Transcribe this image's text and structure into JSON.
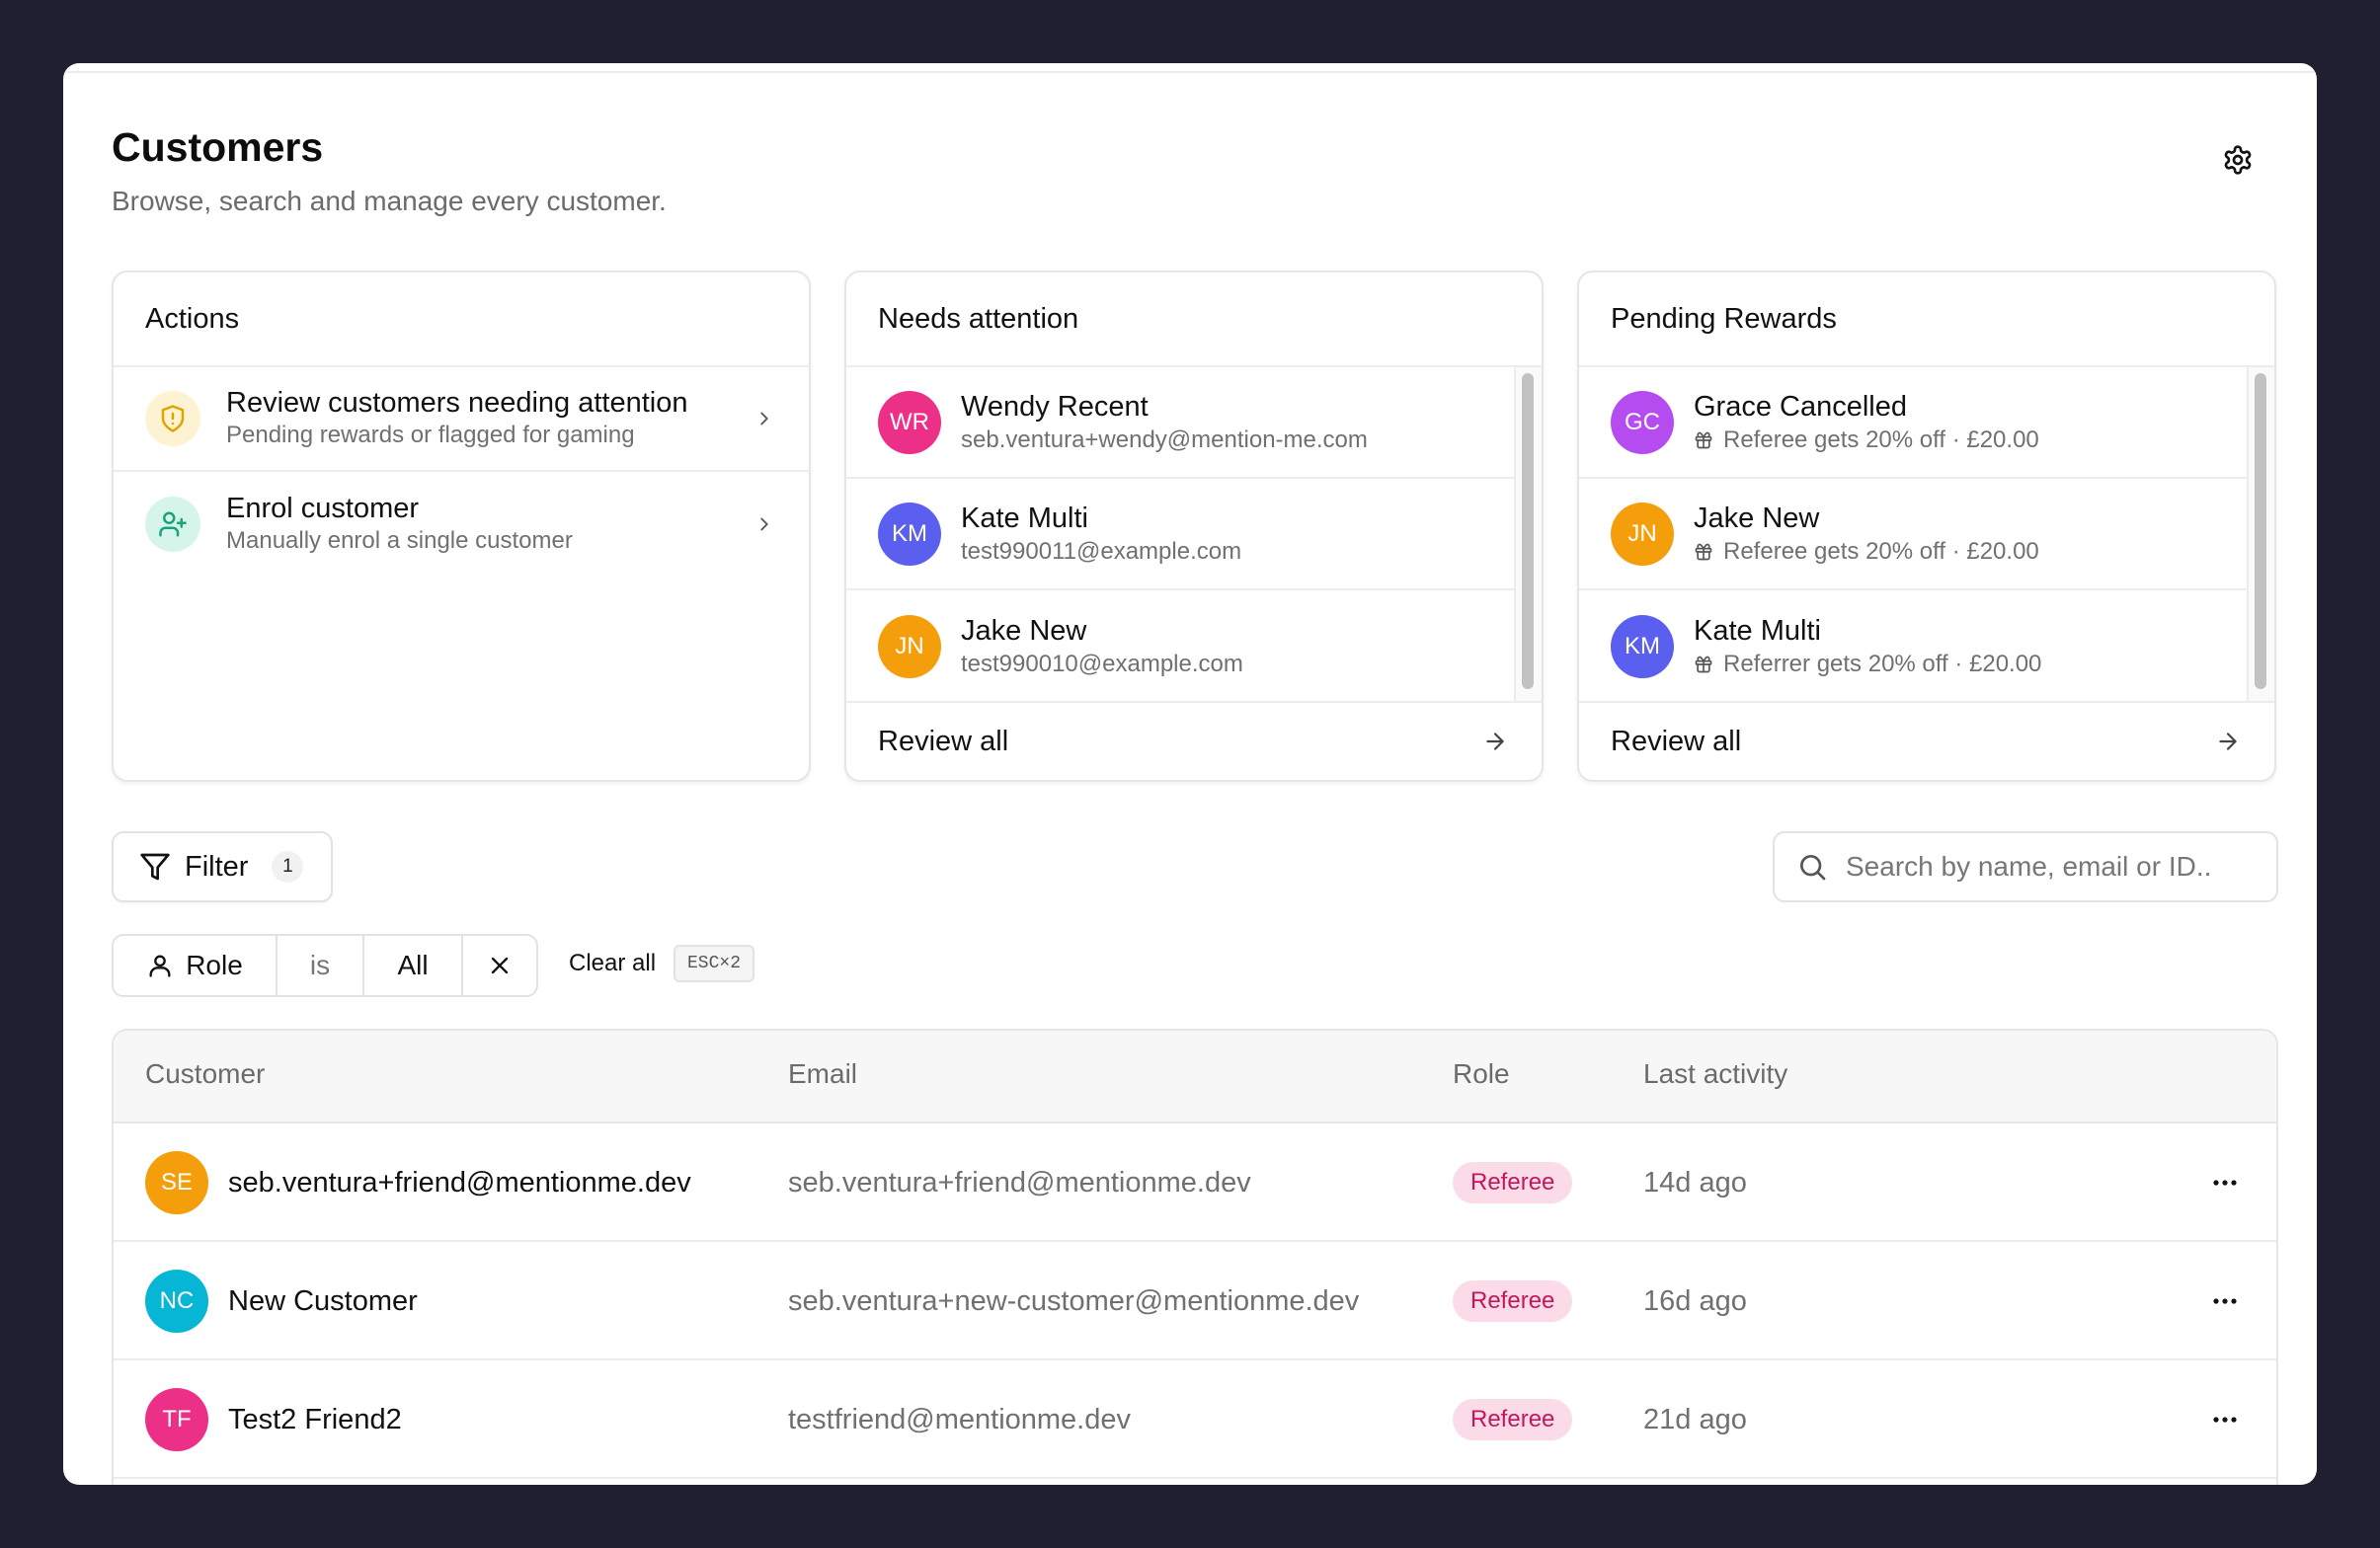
{
  "header": {
    "title": "Customers",
    "subtitle": "Browse, search and manage every customer.",
    "settings_icon": "gear-icon"
  },
  "actions_card": {
    "title": "Actions",
    "items": [
      {
        "title": "Review customers needing attention",
        "description": "Pending rewards or flagged for gaming",
        "icon": "shield-alert-icon",
        "icon_bg": "#fdf3d2",
        "icon_color": "#e0a400"
      },
      {
        "title": "Enrol customer",
        "description": "Manually enrol a single customer",
        "icon": "user-plus-icon",
        "icon_bg": "#d6f5ea",
        "icon_color": "#1aa37a"
      }
    ]
  },
  "needs_attention_card": {
    "title": "Needs attention",
    "items": [
      {
        "initials": "WR",
        "name": "Wendy Recent",
        "email": "seb.ventura+wendy@mention-me.com",
        "color": "#ec2f87"
      },
      {
        "initials": "KM",
        "name": "Kate Multi",
        "email": "test990011@example.com",
        "color": "#5b5fef"
      },
      {
        "initials": "JN",
        "name": "Jake New",
        "email": "test990010@example.com",
        "color": "#f59e0b"
      }
    ],
    "footer": "Review all"
  },
  "pending_rewards_card": {
    "title": "Pending Rewards",
    "items": [
      {
        "initials": "GC",
        "name": "Grace Cancelled",
        "reward": "Referee gets 20% off · £20.00",
        "color": "#b44cf0"
      },
      {
        "initials": "JN",
        "name": "Jake New",
        "reward": "Referee gets 20% off · £20.00",
        "color": "#f59e0b"
      },
      {
        "initials": "KM",
        "name": "Kate Multi",
        "reward": "Referrer gets 20% off · £20.00",
        "color": "#5b5fef"
      }
    ],
    "footer": "Review all"
  },
  "filter": {
    "label": "Filter",
    "count": "1"
  },
  "search": {
    "placeholder": "Search by name, email or ID.."
  },
  "active_filter": {
    "field": "Role",
    "operator": "is",
    "value": "All"
  },
  "clear_all": {
    "label": "Clear all",
    "shortcut": "ESC×2"
  },
  "table": {
    "columns": [
      "Customer",
      "Email",
      "Role",
      "Last activity"
    ],
    "rows": [
      {
        "initials": "SE",
        "name": "seb.ventura+friend@mentionme.dev",
        "email": "seb.ventura+friend@mentionme.dev",
        "role": "Referee",
        "last_activity": "14d ago",
        "color": "#f59e0b"
      },
      {
        "initials": "NC",
        "name": "New Customer",
        "email": "seb.ventura+new-customer@mentionme.dev",
        "role": "Referee",
        "last_activity": "16d ago",
        "color": "#06b6d4"
      },
      {
        "initials": "TF",
        "name": "Test2 Friend2",
        "email": "testfriend@mentionme.dev",
        "role": "Referee",
        "last_activity": "21d ago",
        "color": "#ec2f87"
      }
    ]
  },
  "colors": {
    "background": "#1f1f31",
    "badge_bg": "#fcdbe9",
    "badge_text": "#c2185b"
  }
}
